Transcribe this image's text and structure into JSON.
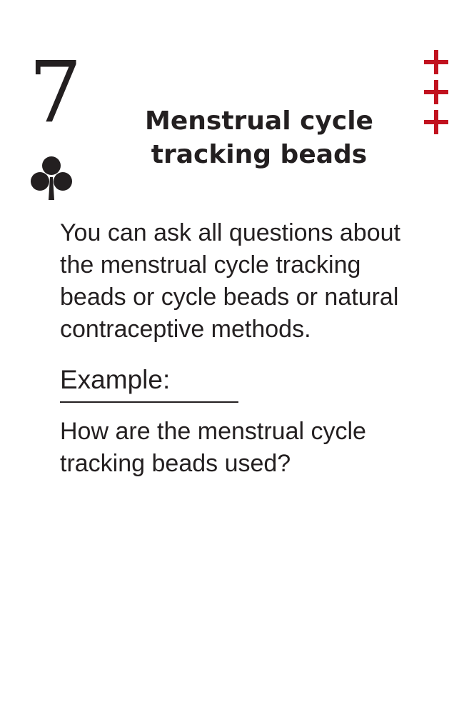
{
  "card": {
    "rank": "7",
    "suit_icon": "club-icon",
    "corner_marks": [
      "plus-icon",
      "plus-icon",
      "plus-icon"
    ],
    "title": "Menstrual cycle tracking beads",
    "description": "You can ask all questions about the menstrual cycle tracking beads or cycle beads or natural contraceptive methods.",
    "example_heading": "Example:",
    "example_text": "How are the menstrual cycle tracking beads used?"
  },
  "colors": {
    "text": "#231f20",
    "accent": "#c1121f",
    "background": "#ffffff"
  }
}
